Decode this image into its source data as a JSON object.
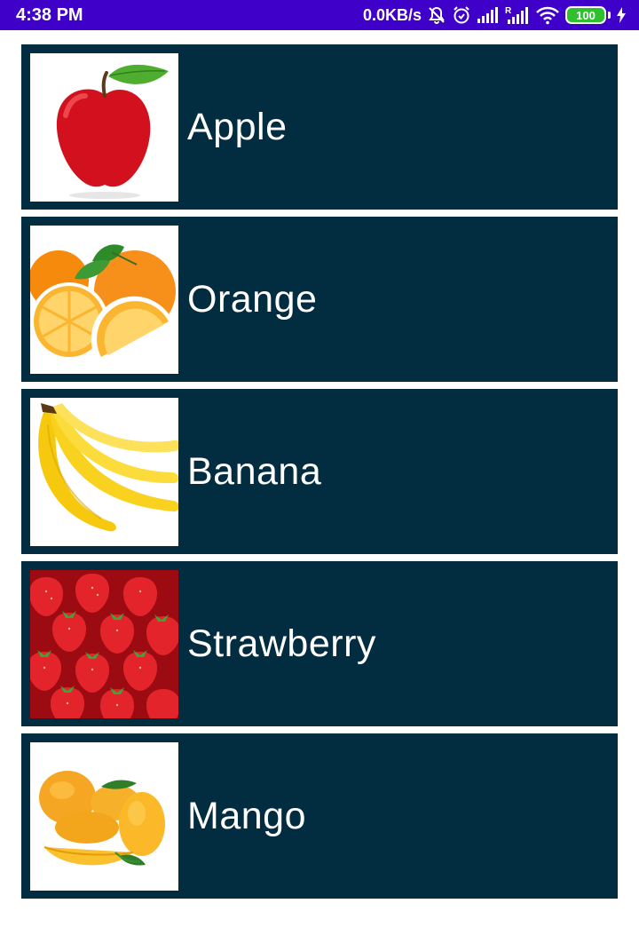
{
  "status_bar": {
    "time": "4:38 PM",
    "net_speed": "0.0KB/s",
    "battery_level": "100",
    "icons": [
      "mute-icon",
      "alarm-icon",
      "signal-icon",
      "roaming-signal-icon",
      "wifi-icon",
      "battery-icon",
      "charging-icon"
    ],
    "background_color": "#3f00c9"
  },
  "list": {
    "card_color": "#022c40",
    "items": [
      {
        "label": "Apple",
        "image": "apple-image"
      },
      {
        "label": "Orange",
        "image": "orange-image"
      },
      {
        "label": "Banana",
        "image": "banana-image"
      },
      {
        "label": "Strawberry",
        "image": "strawberry-image"
      },
      {
        "label": "Mango",
        "image": "mango-image"
      }
    ]
  }
}
